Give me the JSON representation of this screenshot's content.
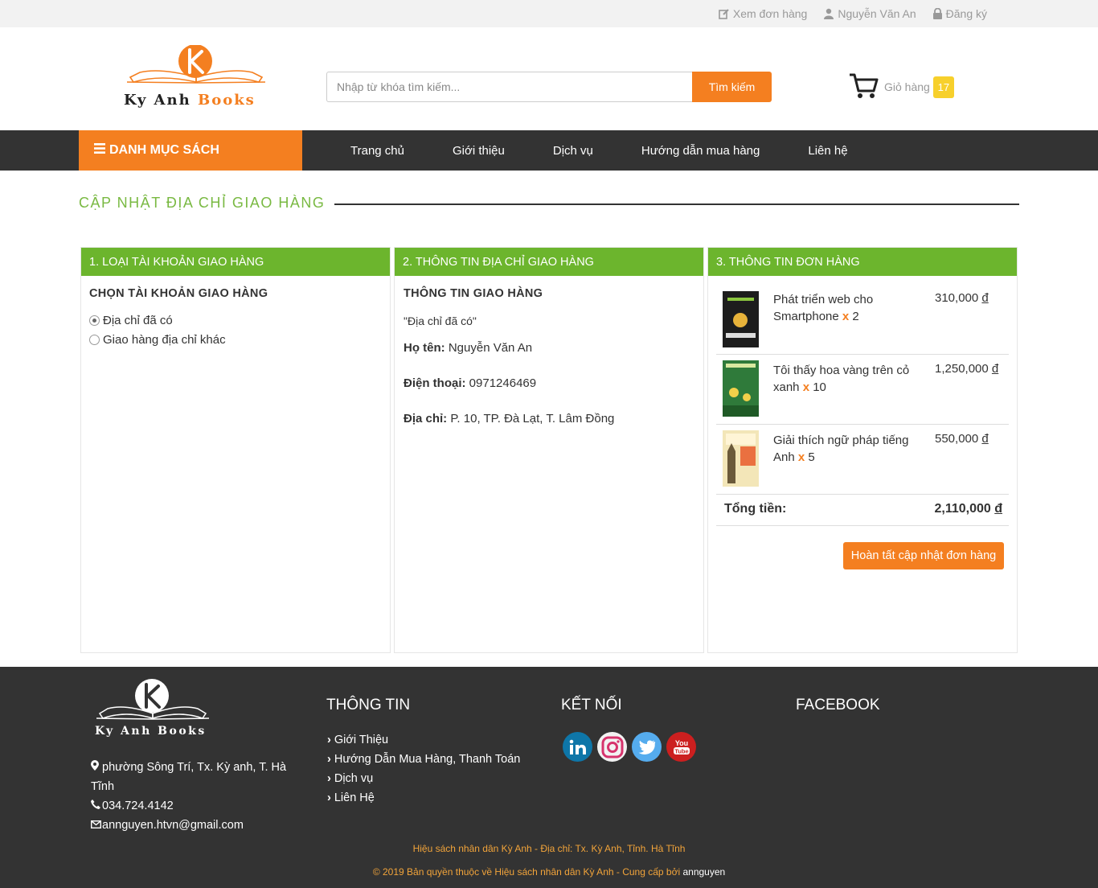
{
  "topbar": {
    "orders": "Xem đơn hàng",
    "user": "Nguyễn Văn An",
    "register": "Đăng ký"
  },
  "header": {
    "logo_main": "Ky Anh",
    "logo_accent": "Books",
    "search_placeholder": "Nhập từ khóa tìm kiếm...",
    "search_button": "Tìm kiếm",
    "cart_label": "Giỏ hàng",
    "cart_count": "17",
    "accent_color": "#f47f20"
  },
  "nav": {
    "category": "DANH MỤC SÁCH",
    "items": [
      "Trang chủ",
      "Giới thiệu",
      "Dịch vụ",
      "Hướng dẫn mua hàng",
      "Liên hệ"
    ]
  },
  "page": {
    "title": "CẬP NHẬT ĐỊA CHỈ GIAO HÀNG"
  },
  "panel1": {
    "header": "1. LOẠI TÀI KHOẢN GIAO HÀNG",
    "subheading": "CHỌN TÀI KHOẢN GIAO HÀNG",
    "options": [
      "Địa chỉ đã có",
      "Giao hàng địa chỉ khác"
    ],
    "selected": "Địa chỉ đã có"
  },
  "panel2": {
    "header": "2. THÔNG TIN ĐỊA CHỈ GIAO HÀNG",
    "subheading": "THÔNG TIN GIAO HÀNG",
    "note": "\"Địa chỉ đã có\"",
    "name_label": "Họ tên:",
    "name": "Nguyễn Văn An",
    "phone_label": "Điện thoại:",
    "phone": "0971246469",
    "address_label": "Địa chỉ:",
    "address": "P. 10, TP. Đà Lạt, T. Lâm Đồng"
  },
  "panel3": {
    "header": "3. THÔNG TIN ĐƠN HÀNG",
    "items": [
      {
        "name": "Phát triển web cho Smartphone",
        "qty": "2",
        "price": "310,000",
        "currency": "đ",
        "cover_color": "#1d1d1d"
      },
      {
        "name": "Tôi thấy hoa vàng trên cỏ xanh",
        "qty": "10",
        "price": "1,250,000",
        "currency": "đ",
        "cover_color": "#2f7a3a"
      },
      {
        "name": "Giải thích ngữ pháp tiếng Anh",
        "qty": "5",
        "price": "550,000",
        "currency": "đ",
        "cover_color": "#f3e6b8"
      }
    ],
    "qty_marker": "x",
    "total_label": "Tổng tiền:",
    "total": "2,110,000",
    "total_currency": "đ",
    "submit": "Hoàn tất cập nhật đơn hàng"
  },
  "footer": {
    "logo_text": "Ky Anh Books",
    "address": "phường Sông Trí, Tx. Kỳ anh, T. Hà Tĩnh",
    "phone": "034.724.4142",
    "email": "annguyen.htvn@gmail.com",
    "col_info": "THÔNG TIN",
    "col_connect": "KẾT NỐI",
    "col_facebook": "FACEBOOK",
    "links": [
      "Giới Thiệu",
      "Hướng Dẫn Mua Hàng, Thanh Toán",
      "Dịch vụ",
      "Liên Hệ"
    ],
    "socials": [
      "linkedin-icon",
      "instagram-icon",
      "twitter-icon",
      "youtube-icon"
    ],
    "copy_line1": "Hiệu sách nhân dân Kỳ Anh - Địa chỉ: Tx. Kỳ Anh, Tỉnh. Hà Tĩnh",
    "copy_line2": "© 2019 Bản quyền thuộc về Hiệu sách nhân dân Kỳ Anh - Cung cấp bởi",
    "copy_author": "annguyen"
  }
}
